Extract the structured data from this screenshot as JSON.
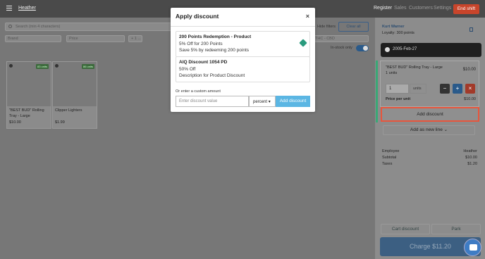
{
  "topbar": {
    "user": "Heather",
    "nav": [
      "Register",
      "Sales",
      "Customers",
      "Settings"
    ],
    "end_shift": "End shift"
  },
  "filters": {
    "search_placeholder": "Search (min 4 characters)",
    "hide": "Hide filters",
    "clear": "Clear all",
    "brand": "Brand",
    "price": "Price",
    "more": "+ 1 ...",
    "thc": "THC - CBD",
    "instock": "In-stock only",
    "instock_on": true
  },
  "products": [
    {
      "name": "\"BEST BUD\" Rolling Tray - Large",
      "price": "$10.00",
      "stock": "83 units"
    },
    {
      "name": "Clipper Lighters",
      "price": "$1.99",
      "stock": "86 units"
    }
  ],
  "cart": {
    "customer": "Kurt Warner",
    "loyalty": "Loyalty: 300 points",
    "date": "2005-Feb-27",
    "item": {
      "name": "\"BEST BUD\" Rolling Tray - Large",
      "units": "1 units",
      "price": "$10.00",
      "qty": "1",
      "unit_label": "units",
      "ppu_label": "Price per unit",
      "ppu": "$10.00"
    },
    "add_discount": "Add discount",
    "add_line": "Add as new line",
    "summary": [
      {
        "k": "Employee",
        "v": "Heather"
      },
      {
        "k": "Subtotal",
        "v": "$10.00"
      },
      {
        "k": "Taxes",
        "v": "$1.20"
      }
    ],
    "cart_discount": "Cart discount",
    "park": "Park",
    "charge": "Charge $11.20"
  },
  "modal": {
    "title": "Apply discount",
    "close": "×",
    "options": [
      {
        "title": "200 Points Redemption - Product",
        "line1": "5% Off for 200 Points",
        "line2": "Save 5% by redeeming 200 points"
      },
      {
        "title": "AIQ Discount 1054 PD",
        "line1": "50% Off",
        "line2": "Description for Product Discount"
      }
    ],
    "custom_label": "Or enter a custom amount",
    "input_placeholder": "Enter discount value",
    "type": "percent",
    "apply": "Add discount"
  }
}
